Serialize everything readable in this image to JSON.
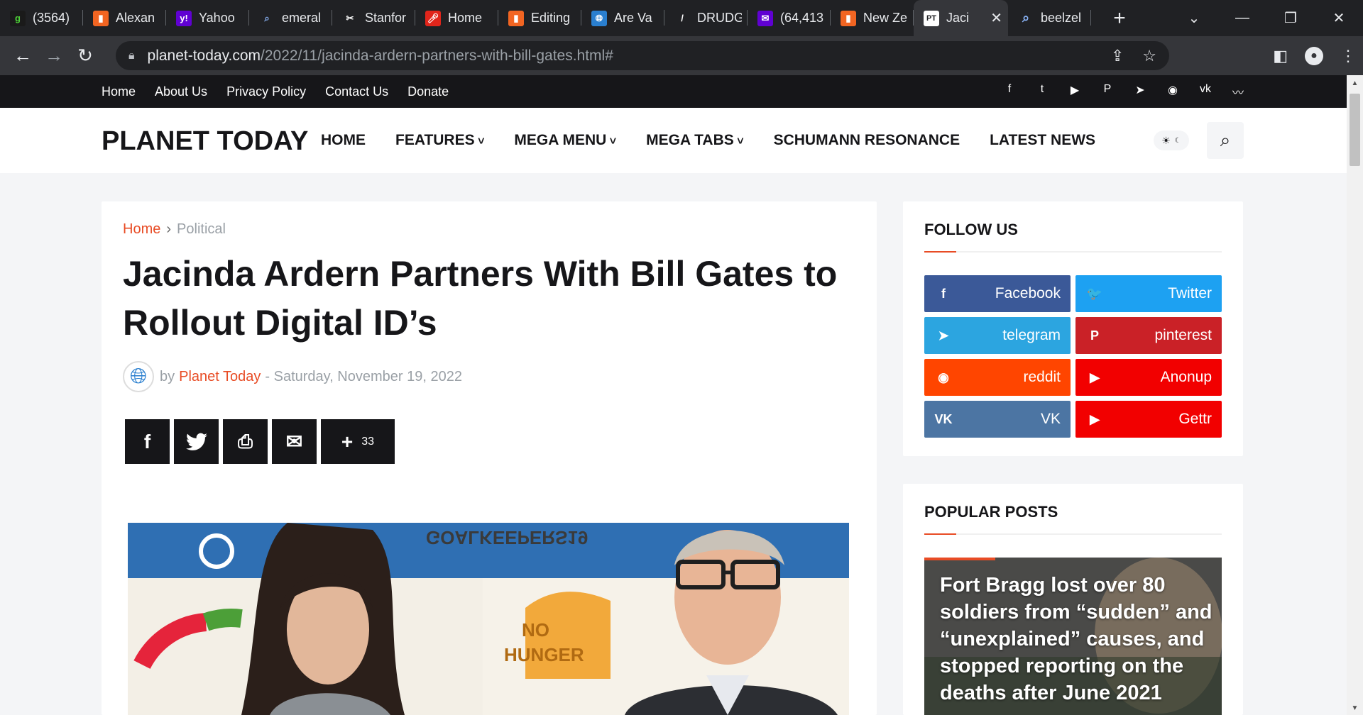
{
  "browser": {
    "tabs": [
      {
        "icon": "g",
        "title": "(3564)",
        "color": "#1a1a1a",
        "fg": "#4cd137"
      },
      {
        "icon": "bookmark",
        "title": "Alexan",
        "color": "#f26522"
      },
      {
        "icon": "y!",
        "title": "Yahoo",
        "color": "#6001d2"
      },
      {
        "icon": "search",
        "title": "emeral",
        "color": "#202124"
      },
      {
        "icon": "stanford",
        "title": "Stanfor",
        "color": "#202124"
      },
      {
        "icon": "mic",
        "title": "Home",
        "color": "#e1251b"
      },
      {
        "icon": "bookmark",
        "title": "Editing",
        "color": "#f26522"
      },
      {
        "icon": "globe",
        "title": "Are Va",
        "color": "#2a7fcf"
      },
      {
        "icon": "drudge",
        "title": "DRUDG",
        "color": "#202124"
      },
      {
        "icon": "mail",
        "title": "(64,413",
        "color": "#6001d2"
      },
      {
        "icon": "bookmark",
        "title": "New Ze",
        "color": "#f26522"
      }
    ],
    "active_tab": {
      "icon": "PT",
      "title": "Jaci",
      "close": "✕"
    },
    "last_tab": {
      "icon": "search",
      "title": "beelzel"
    },
    "newtab": "+",
    "url_domain": "planet-today.com",
    "url_path": "/2022/11/jacinda-ardern-partners-with-bill-gates.html#"
  },
  "site": {
    "top_links": [
      "Home",
      "About Us",
      "Privacy Policy",
      "Contact Us",
      "Donate"
    ],
    "social_icons": [
      "facebook-icon",
      "twitter-icon",
      "youtube-icon",
      "pinterest-icon",
      "telegram-icon",
      "reddit-icon",
      "vk-icon",
      "rss-icon"
    ],
    "logo": "PLANET TODAY",
    "nav": [
      {
        "label": "HOME",
        "dropdown": false
      },
      {
        "label": "FEATURES",
        "dropdown": true
      },
      {
        "label": "MEGA MENU",
        "dropdown": true
      },
      {
        "label": "MEGA TABS",
        "dropdown": true
      },
      {
        "label": "SCHUMANN RESONANCE",
        "dropdown": false
      },
      {
        "label": "LATEST NEWS",
        "dropdown": false
      }
    ]
  },
  "article": {
    "breadcrumb_home": "Home",
    "breadcrumb_sep": "›",
    "breadcrumb_category": "Political",
    "title": "Jacinda Ardern Partners With Bill Gates to Rollout Digital ID’s",
    "by": "by",
    "author": "Planet Today",
    "date": "- Saturday, November 19, 2022",
    "share_count": "33",
    "photo_text_1": "GOALKEEPERS19",
    "photo_text_2": "NO",
    "photo_text_3": "HUNGER"
  },
  "follow": {
    "heading": "FOLLOW US",
    "buttons": [
      {
        "label": "Facebook",
        "icon": "facebook-icon",
        "glyph": "f",
        "color": "#3b5998"
      },
      {
        "label": "Twitter",
        "icon": "twitter-icon",
        "glyph": "🐦",
        "color": "#1da1f2"
      },
      {
        "label": "telegram",
        "icon": "telegram-icon",
        "glyph": "➤",
        "color": "#2ca5e0"
      },
      {
        "label": "pinterest",
        "icon": "pinterest-icon",
        "glyph": "P",
        "color": "#ca2127"
      },
      {
        "label": "reddit",
        "icon": "reddit-icon",
        "glyph": "◉",
        "color": "#ff4500"
      },
      {
        "label": "Anonup",
        "icon": "youtube-icon",
        "glyph": "▶",
        "color": "#f20000"
      },
      {
        "label": "VK",
        "icon": "vk-icon",
        "glyph": "VK",
        "color": "#4c75a3"
      },
      {
        "label": "Gettr",
        "icon": "youtube-icon",
        "glyph": "▶",
        "color": "#f20000"
      }
    ]
  },
  "popular": {
    "heading": "POPULAR POSTS",
    "post_title": "Fort Bragg lost over 80 soldiers from “sudden” and “unexplained” causes, and stopped reporting on the deaths after June 2021"
  }
}
